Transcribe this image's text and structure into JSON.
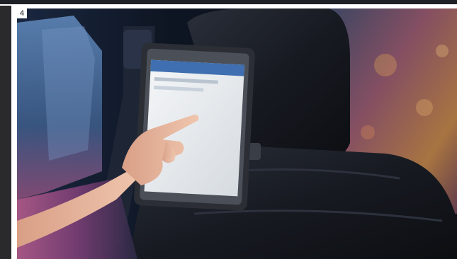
{
  "figure": {
    "number": "4"
  },
  "colors": {
    "cabin_dark": "#10141c",
    "seat_leather": "#1c1f26",
    "window_blue": "#4c6a8f",
    "window_magenta": "#a8567a",
    "window_amber": "#c98a44",
    "screen_white": "#e9ecef",
    "skin": "#e8b9a0",
    "tablet_frame": "#2b2e34"
  }
}
